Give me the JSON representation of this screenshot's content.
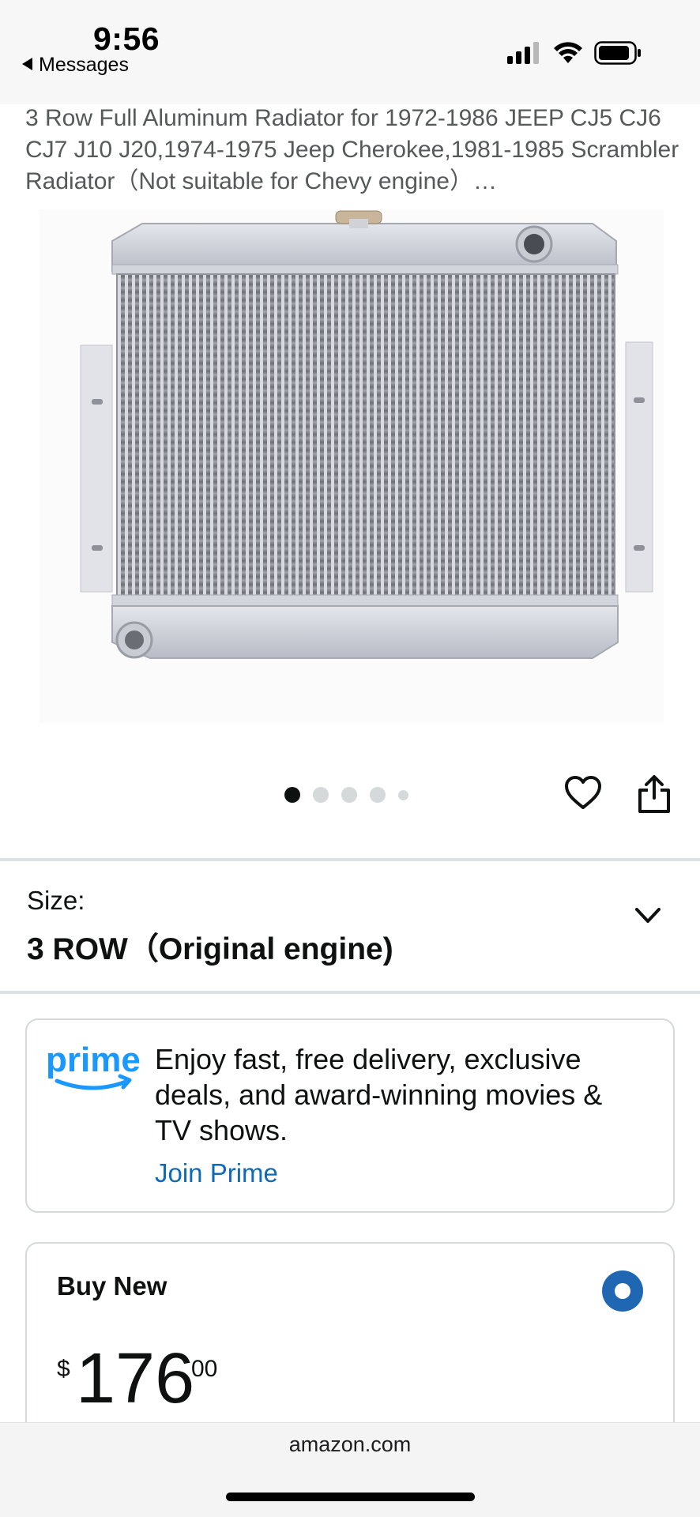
{
  "status_bar": {
    "time": "9:56",
    "back_label": "Messages",
    "icons": [
      "signal-icon",
      "wifi-icon",
      "battery-icon"
    ]
  },
  "product": {
    "title": "3 Row Full Aluminum Radiator for 1972-1986 JEEP CJ5 CJ6 CJ7 J10 J20,1974-1975 Jeep Cherokee,1981-1985 Scrambler Radiator（Not suitable for Chevy engine）…",
    "image_alt": "aluminum radiator",
    "carousel": {
      "total": 5,
      "active_index": 0
    }
  },
  "size": {
    "label": "Size:",
    "value": "3 ROW（Original engine)"
  },
  "prime": {
    "logo_text": "prime",
    "message": "Enjoy fast, free delivery, exclusive deals, and award-winning movies & TV shows.",
    "link": "Join Prime"
  },
  "buy_new": {
    "title": "Buy New",
    "selected": true,
    "price_symbol": "$",
    "price_whole": "176",
    "price_fraction": "00"
  },
  "browser": {
    "url": "amazon.com"
  },
  "colors": {
    "prime_blue": "#1a98ff",
    "link_blue": "#0f6bb6",
    "radio_blue": "#1f67b3",
    "text": "#0f1111",
    "title_gray": "#565959"
  }
}
